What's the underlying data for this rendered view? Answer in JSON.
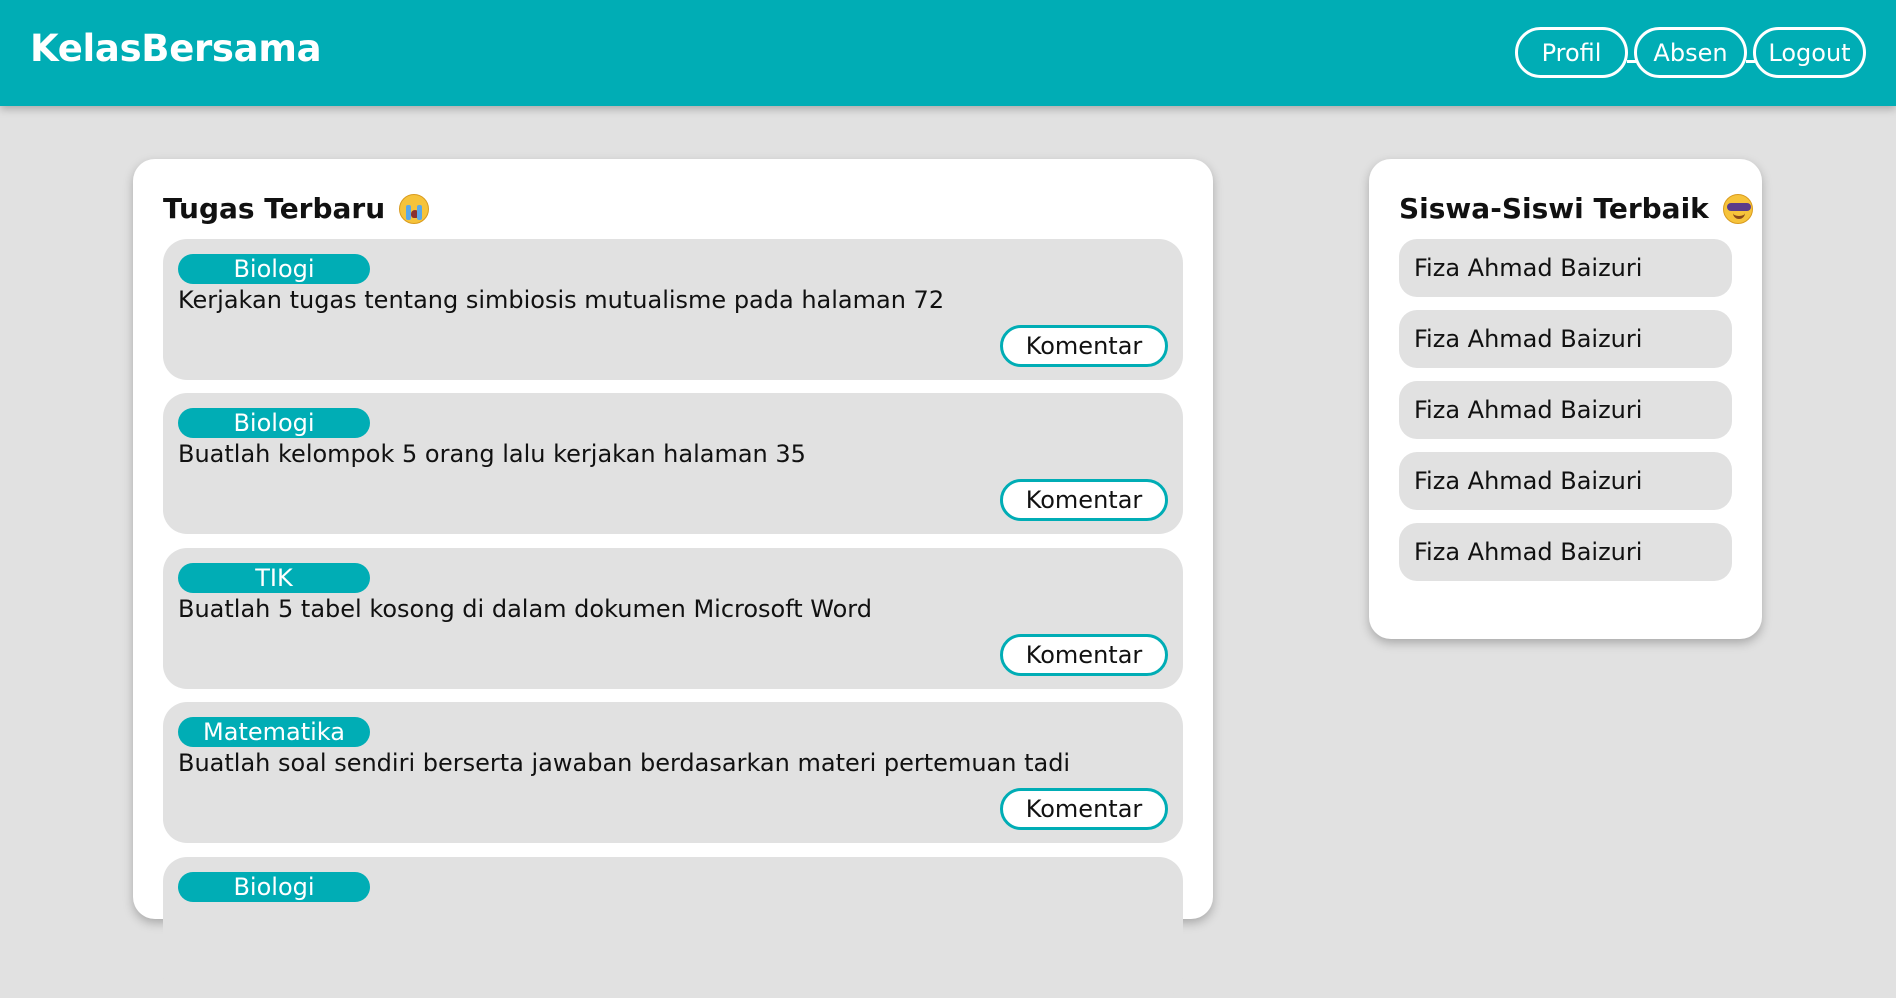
{
  "navbar": {
    "brand": "KelasBersama",
    "buttons": [
      "Profil",
      "Absen",
      "Logout"
    ],
    "background_color": "#00adb5"
  },
  "tasks_card": {
    "title": "Tugas Terbaru",
    "title_icon": "crying-face-icon",
    "tasks": [
      {
        "subject": "Biologi",
        "text": "Kerjakan tugas tentang simbiosis mutualisme pada halaman 72",
        "button": "Komentar"
      },
      {
        "subject": "Biologi",
        "text": "Buatlah kelompok 5 orang lalu kerjakan halaman 35",
        "button": "Komentar"
      },
      {
        "subject": "TIK",
        "text": "Buatlah 5 tabel kosong di dalam dokumen Microsoft Word",
        "button": "Komentar"
      },
      {
        "subject": "Matematika",
        "text": "Buatlah soal sendiri berserta jawaban berdasarkan materi pertemuan tadi",
        "button": "Komentar"
      },
      {
        "subject": "Biologi"
      }
    ]
  },
  "students_card": {
    "title": "Siswa-Siswi Terbaik",
    "title_icon": "sunglasses-face-icon",
    "students": [
      "Fiza Ahmad Baizuri",
      "Fiza Ahmad Baizuri",
      "Fiza Ahmad Baizuri",
      "Fiza Ahmad Baizuri",
      "Fiza Ahmad Baizuri"
    ]
  }
}
